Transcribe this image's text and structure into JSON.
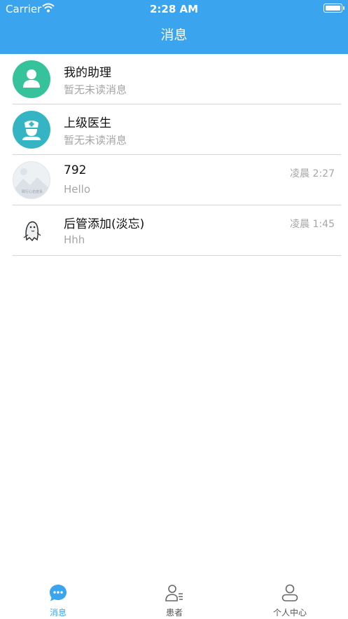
{
  "status_bar": {
    "carrier": "Carrier",
    "time": "2:28 AM"
  },
  "nav": {
    "title": "消息"
  },
  "conversations": [
    {
      "name": "我的助理",
      "preview": "暂无未读消息",
      "time": "",
      "avatar": "assistant-avatar",
      "color": "#36c39b"
    },
    {
      "name": "上级医生",
      "preview": "暂无未读消息",
      "time": "",
      "avatar": "doctor-avatar",
      "color": "#35b5c4"
    },
    {
      "name": "792",
      "preview": "Hello",
      "time": "凌晨 2:27",
      "avatar": "landscape-placeholder-avatar",
      "avatar_text": "瞬行心岩度系"
    },
    {
      "name": "后管添加(淡忘)",
      "preview": "Hhh",
      "time": "凌晨 1:45",
      "avatar": "ghost-sketch-avatar"
    }
  ],
  "tabs": [
    {
      "label": "消息",
      "icon": "chat-bubble-icon",
      "active": true
    },
    {
      "label": "患者",
      "icon": "patient-list-icon",
      "active": false
    },
    {
      "label": "个人中心",
      "icon": "profile-icon",
      "active": false
    }
  ],
  "colors": {
    "accent": "#3aa4ee",
    "assistant": "#36c39b",
    "doctor": "#35b5c4",
    "muted": "#a6a6a6"
  }
}
